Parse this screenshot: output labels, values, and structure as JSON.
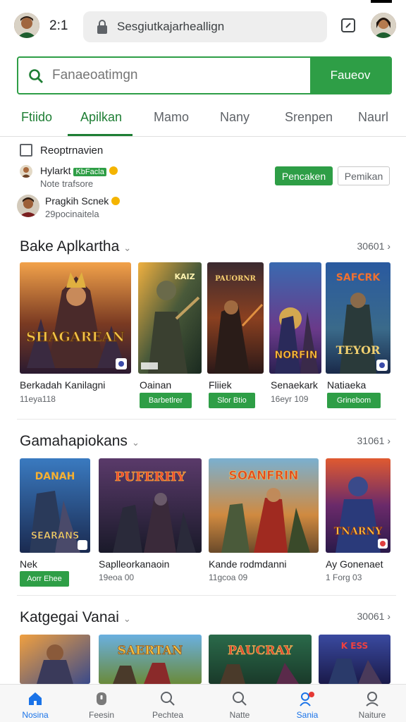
{
  "status": {
    "clock": "2:1"
  },
  "urlbar": {
    "url": "Sesgiutkajarheallign"
  },
  "search": {
    "placeholder": "Fanaeoatimgn",
    "button_label": "Faueov"
  },
  "tabs": [
    "Ftiido",
    "Apilkan",
    "Mamo",
    "Nany",
    "Srenpen",
    "Naurl"
  ],
  "review": {
    "checkbox_label": "Reoptrnavien",
    "row1": {
      "name": "Hylarkt",
      "tag": "KbFacla",
      "sub": "Note trafsore"
    },
    "accept_label": "Pencaken",
    "decline_label": "Pemikan",
    "row2": {
      "name": "Pragkih Scnek",
      "sub": "29pocinaitela"
    }
  },
  "sections": [
    {
      "title": "Bake Aplkartha",
      "more": "30601",
      "items": [
        {
          "title": "Berkadah Kanilagni",
          "sub": "11eya118",
          "art_text": "SHAGAREAN"
        },
        {
          "title": "Oainan",
          "button": "Barbetlrer",
          "art_text": "KAIZ"
        },
        {
          "title": "Fliiek",
          "button": "Slor Btio",
          "art_text": "PAUORNR"
        },
        {
          "title": "Senaekark",
          "sub": "16eyr 109",
          "art_text": "NORFIN"
        },
        {
          "title": "Natiaeka",
          "button": "Grinebom",
          "art_text": "TEYOR"
        }
      ]
    },
    {
      "title": "Gamahapiokans",
      "more": "31061",
      "items": [
        {
          "title": "Nek",
          "button": "Aorr Ehee",
          "art_text": "SEARANS"
        },
        {
          "title": "Saplleorkanaoin",
          "sub": "19eoa 00",
          "art_text": "PUFERHY"
        },
        {
          "title": "Kande rodmdanni",
          "sub": "11gcoa 09",
          "art_text": "SOANFRIN"
        },
        {
          "title": "Ay Gonenaet",
          "sub": "1 Forg 03",
          "art_text": "TNARNY"
        }
      ]
    },
    {
      "title": "Katgegai Vanai",
      "more": "30061",
      "items": [
        {
          "art_text": ""
        },
        {
          "art_text": "SAERTAN"
        },
        {
          "art_text": "PAUCRAY"
        },
        {
          "art_text": "K ESS"
        }
      ]
    }
  ],
  "bottom_nav": [
    {
      "label": "Nosina",
      "icon": "home-icon",
      "active": true
    },
    {
      "label": "Feesin",
      "icon": "gamepad-icon"
    },
    {
      "label": "Pechtea",
      "icon": "search-icon"
    },
    {
      "label": "Natte",
      "icon": "search-icon"
    },
    {
      "label": "Sania",
      "icon": "people-icon"
    },
    {
      "label": "Naiture",
      "icon": "person-icon"
    }
  ],
  "colors": {
    "accent": "#2e9e46",
    "active_nav": "#1a73e8",
    "tab_active": "#1e7e34"
  }
}
